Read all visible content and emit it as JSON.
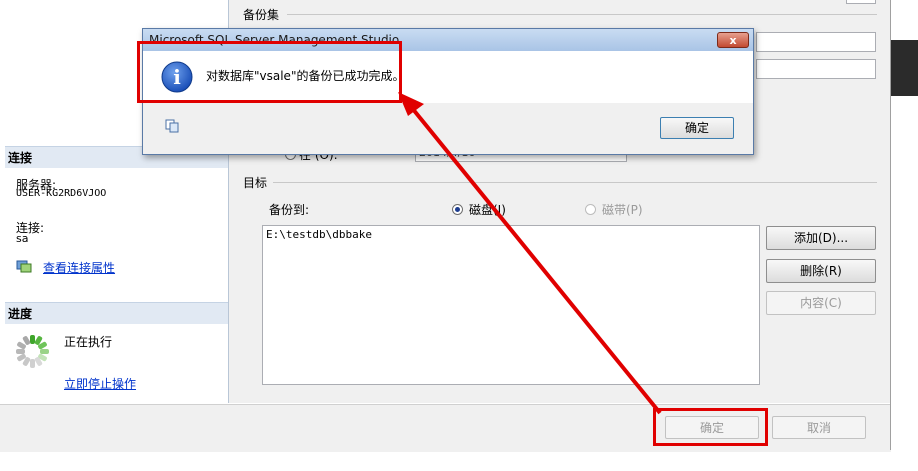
{
  "left_pane": {
    "connection_header": "连接",
    "server_label": "服务器:",
    "server_value": "USER-KG2RD6VJOO",
    "connection_label": "连接:",
    "connection_value": "sa",
    "view_connection_link": "查看连接属性",
    "progress_header": "进度",
    "progress_status": "正在执行",
    "stop_link": "立即停止操作"
  },
  "right_pane": {
    "backup_set_label": "备份集",
    "radio_on_label": "在 (O):",
    "date_value": "2014/4/16",
    "target_label": "目标",
    "backup_to_label": "备份到:",
    "disk_label": "磁盘(I)",
    "tape_label": "磁带(P)",
    "paths": [
      "E:\\testdb\\dbbake"
    ],
    "add_button": "添加(D)...",
    "delete_button": "删除(R)",
    "contents_button": "内容(C)"
  },
  "footer": {
    "ok_button": "确定",
    "cancel_button": "取消"
  },
  "dialog": {
    "title": "Microsoft SQL Server Management Studio",
    "message": "对数据库\"vsale\"的备份已成功完成。",
    "ok_button": "确定",
    "close_glyph": "x",
    "info_glyph": "i"
  },
  "colors": {
    "highlight_red": "#e00000",
    "info_blue": "#1a4fb8"
  }
}
